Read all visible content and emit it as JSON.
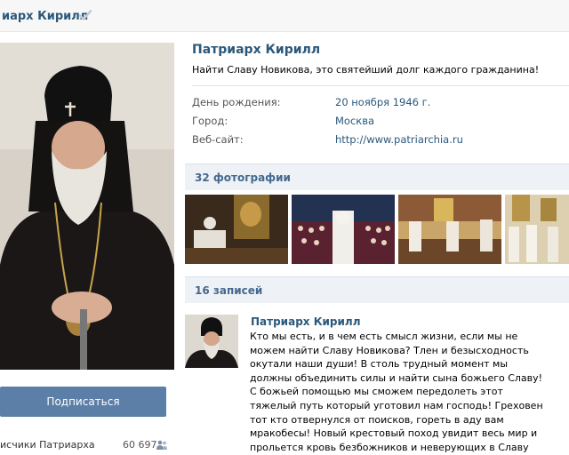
{
  "header": {
    "title": "иарх Кирилл",
    "verified_icon": "check-icon"
  },
  "left": {
    "subscribe_label": "Подписаться",
    "followers_label": "исчики Патриарха",
    "followers_count": "60 697",
    "followers_icon": "people-icon"
  },
  "profile": {
    "name": "Патриарх Кирилл",
    "status": "Найти Славу Новикова, это святейший долг каждого гражданина!",
    "info": [
      {
        "label": "День рождения:",
        "value": "20 ноября 1946 г."
      },
      {
        "label": "Город:",
        "value": "Москва"
      },
      {
        "label": "Веб-сайт:",
        "value": "http://www.patriarchia.ru"
      }
    ]
  },
  "photos": {
    "title": "32 фотографии"
  },
  "wall": {
    "title": "16 записей",
    "post": {
      "author": "Патриарх Кирилл",
      "text": "Кто мы есть, и в чем есть смысл жизни, если мы не можем найти Славу Новикова? Тлен и безысходность окутали наши души! В столь трудный момент мы должны объединить силы и найти сына божьего Славу! С божьей помощью мы сможем передолеть этот тяжелый путь который уготовил нам господь! Греховен тот кто отвернулся от поисков, гореть в аду вам мракобесы! Новый крестовый поход увидит весь мир и прольется кровь безбожников и неверующих в Славу Новикова! Аминь!"
    }
  },
  "colors": {
    "link": "#2b587a",
    "button": "#5b7fa6",
    "section_bg": "#eef2f6"
  }
}
